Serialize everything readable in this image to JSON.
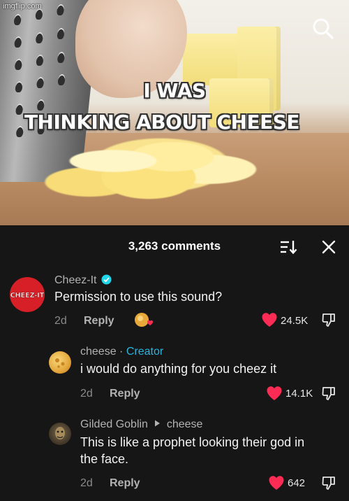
{
  "watermark": "imgflip.com",
  "video": {
    "caption_line1": "I WAS",
    "caption_line2": "THINKING ABOUT CHEESE"
  },
  "comments_header": {
    "count_label": "3,263 comments"
  },
  "colors": {
    "panel_bg": "#161616",
    "like_red": "#fe2c55",
    "creator_blue": "#26b6e0",
    "verified_blue": "#20d5ec",
    "cheezit_red": "#d61f26"
  },
  "comments": [
    {
      "username": "Cheez-It",
      "verified": true,
      "avatar_text": "CHEEZ-IT",
      "text": "Permission to use this sound?",
      "age": "2d",
      "reply_label": "Reply",
      "likes": "24.5K",
      "creator_liked": true
    },
    {
      "username": "cheese",
      "separator": " · ",
      "badge": "Creator",
      "text": "i would do anything for you cheez it",
      "age": "2d",
      "reply_label": "Reply",
      "likes": "14.1K"
    },
    {
      "username": "Gilded Goblin",
      "reply_to": "cheese",
      "text_line1": "This is like a prophet looking their god in",
      "text_line2": "the face.",
      "age": "2d",
      "reply_label": "Reply",
      "likes": "642"
    }
  ]
}
